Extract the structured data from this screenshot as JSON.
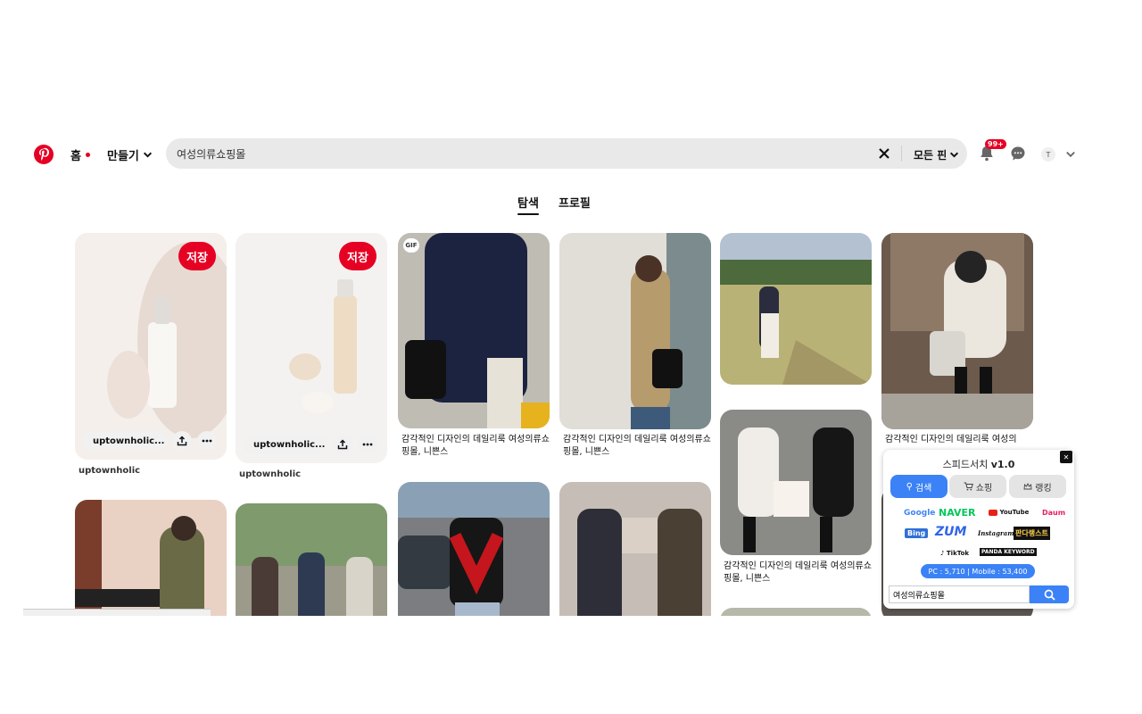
{
  "header": {
    "nav_home": "홈",
    "nav_create": "만들기",
    "search_value": "여성의류쇼핑몰",
    "filter_label": "모든 핀",
    "notif_badge": "99+",
    "avatar_letter": "T"
  },
  "tabs": [
    {
      "label": "탐색"
    },
    {
      "label": "프로필"
    }
  ],
  "pins": [
    {
      "save": "저장",
      "link": "uptownholic...",
      "author": "uptownholic"
    },
    {
      "save": "저장",
      "link": "uptownholic...",
      "author": "uptownholic"
    },
    {
      "gif": "GIF",
      "caption": "감각적인 디자인의 데일리룩 여성의류쇼핑몰, 니쁜스"
    },
    {
      "caption": "감각적인 디자인의 데일리룩 여성의류쇼핑몰, 니쁜스"
    },
    {
      "caption": "감각적인 디자인의 데일리룩 여성의류쇼핑몰, 니쁜스"
    },
    {
      "caption": "감각적인 디자인의 데일리룩 여성의"
    }
  ],
  "extension": {
    "title": "스피드서치",
    "version": "v1.0",
    "tabs": [
      "검색",
      "쇼핑",
      "랭킹"
    ],
    "engines": [
      "Google",
      "NAVER",
      "YouTube",
      "Daum",
      "Bing",
      "ZUM",
      "Instagram",
      "판다랭스트",
      "TikTok",
      "PANDA KEYWORD"
    ],
    "stats": "PC : 5,710  |  Mobile : 53,400",
    "input_value": "여성의류쇼핑몰"
  },
  "colors": {
    "accent": "#e60023",
    "ext_blue": "#3b82f6"
  }
}
